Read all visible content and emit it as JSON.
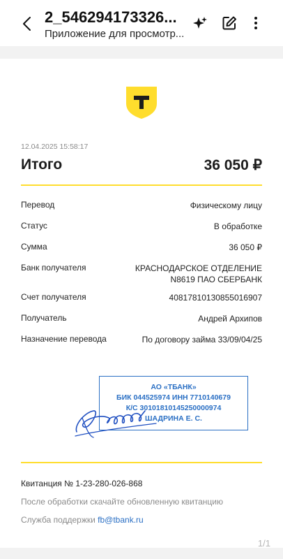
{
  "appbar": {
    "title": "2_546294173326...",
    "subtitle": "Приложение для просмотр..."
  },
  "receipt": {
    "datetime": "12.04.2025  15:58:17",
    "total_label": "Итого",
    "total_value": "36 050 ₽",
    "rows": [
      {
        "label": "Перевод",
        "value": "Физическому лицу"
      },
      {
        "label": "Статус",
        "value": "В обработке"
      },
      {
        "label": "Сумма",
        "value": "36 050 ₽"
      },
      {
        "label": "Банк получателя",
        "value": "КРАСНОДАРСКОЕ ОТДЕЛЕНИЕ",
        "value2": "N8619 ПАО СБЕРБАНК"
      },
      {
        "label": "Счет получателя",
        "value": "40817810130855016907"
      },
      {
        "label": "Получатель",
        "value": "Андрей Архипов"
      },
      {
        "label": "Назначение перевода",
        "value": "По договору займа 33/09/04/25"
      }
    ],
    "stamp": {
      "line1": "АО «ТБАНК»",
      "line2": "БИК 044525974 ИНН 7710140679",
      "line3": "К/С 30101810145250000974",
      "line4": "ШАДРИНА Е. С."
    },
    "receipt_number": "Квитанция  № 1-23-280-026-868",
    "note": "После обработки скачайте обновленную квитанцию",
    "support_label": "Служба поддержки",
    "support_link": "fb@tbank.ru"
  },
  "page_indicator": "1/1",
  "colors": {
    "brand_yellow": "#ffdd2d",
    "stamp_blue": "#2a6fc4",
    "muted_text": "#8a8a8a"
  },
  "icons": {
    "back": "arrow-left-icon",
    "ai": "sparkle-icon",
    "edit": "edit-icon",
    "more": "more-vertical-icon",
    "logo": "tbank-shield-logo"
  }
}
